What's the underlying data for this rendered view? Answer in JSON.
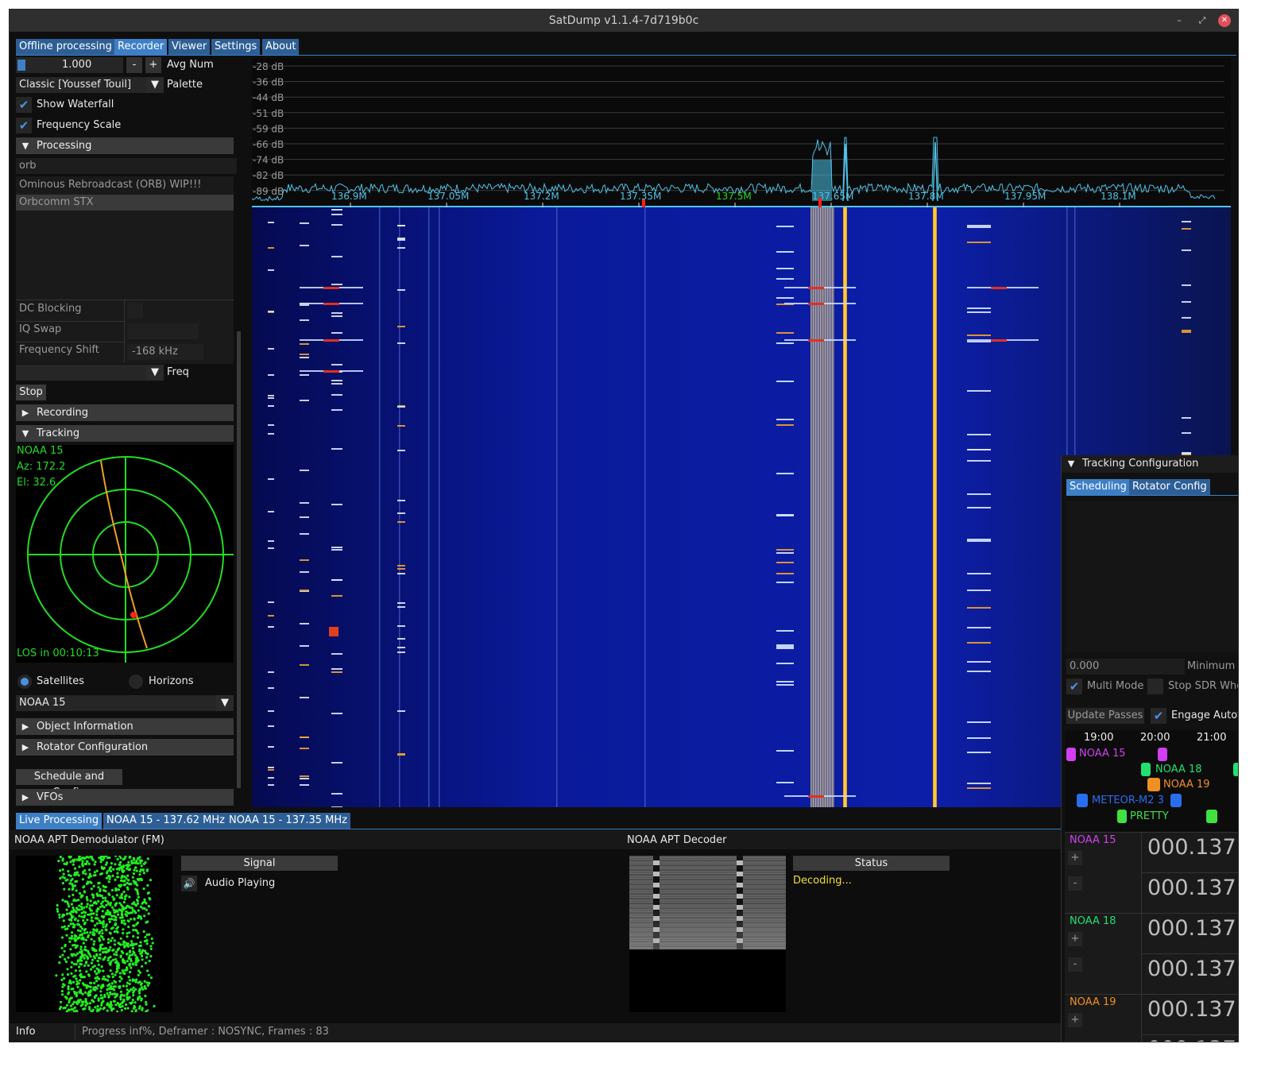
{
  "window": {
    "title": "SatDump v1.1.4-7d719b0c",
    "min": "–",
    "max": "⤢",
    "close": "✕"
  },
  "tabs": [
    "Offline processing",
    "Recorder",
    "Viewer",
    "Settings",
    "About"
  ],
  "left": {
    "avg_value": "1.000",
    "minus": "-",
    "plus": "+",
    "avg_label": "Avg Num",
    "palette_value": "Classic [Youssef Touil]",
    "palette_label": "Palette",
    "show_waterfall": "Show Waterfall",
    "frequency_scale": "Frequency Scale",
    "processing_header": "Processing",
    "pipeline_search": "orb",
    "pipelines": [
      "Ominous Rebroadcast (ORB) WIP!!!",
      "Orbcomm STX"
    ],
    "dc_blocking": "DC Blocking",
    "iq_swap": "IQ Swap",
    "freq_shift_label": "Frequency Shift",
    "freq_shift_value": "-168 kHz",
    "freq_label": "Freq",
    "stop": "Stop",
    "recording": "Recording",
    "tracking": "Tracking",
    "polar": {
      "sat": "NOAA 15",
      "az": "Az: 172.2",
      "el": "El: 32.6",
      "los": "LOS in 00:10:13"
    },
    "satellites": "Satellites",
    "horizons": "Horizons",
    "sat_select": "NOAA 15",
    "object_info": "Object Information",
    "rotator_config": "Rotator Configuration",
    "schedule": "Schedule and Config",
    "vfos": "VFOs"
  },
  "spectrum": {
    "db_labels": [
      "-28 dB",
      "-36 dB",
      "-44 dB",
      "-51 dB",
      "-59 dB",
      "-66 dB",
      "-74 dB",
      "-82 dB",
      "-89 dB"
    ],
    "freq_labels": [
      "136.9M",
      "137.05M",
      "137.2M",
      "137.35M",
      "137.5M",
      "137.65M",
      "137.8M",
      "137.95M",
      "138.1M"
    ],
    "center_color": "#22dd22",
    "trace_color": "#4fc3e8"
  },
  "bottom_tabs": [
    "Live Processing",
    "NOAA 15 - 137.62 MHz",
    "NOAA 15 - 137.35 MHz"
  ],
  "demod": {
    "title": "NOAA APT Demodulator (FM)",
    "signal": "Signal",
    "audio": "Audio Playing"
  },
  "decoder": {
    "title": "NOAA APT Decoder",
    "status": "Status",
    "decoding": "Decoding..."
  },
  "statusbar": {
    "info": "Info",
    "text": "Progress inf%, Deframer : NOSYNC, Frames : 83"
  },
  "tracking_config": {
    "title": "Tracking Configuration",
    "tab_scheduling": "Scheduling",
    "tab_rotator": "Rotator Config",
    "min_value": "0.000",
    "min_label": "Minimum I",
    "multi_mode": "Multi Mode",
    "stop_sdr": "Stop SDR Whe",
    "update_passes": "Update Passes",
    "engage": "Engage Autotr",
    "times": [
      "19:00",
      "20:00",
      "21:00"
    ],
    "passes": [
      {
        "name": "NOAA 15",
        "color": "#d040f0"
      },
      {
        "name": "NOAA 18",
        "color": "#22e070"
      },
      {
        "name": "NOAA 19",
        "color": "#f09020"
      },
      {
        "name": "METEOR-M2 3",
        "color": "#2a6ef0"
      },
      {
        "name": "PRETTY",
        "color": "#40e040"
      }
    ],
    "vfo_sats": [
      {
        "name": "NOAA 15",
        "color": "#d040f0"
      },
      {
        "name": "NOAA 18",
        "color": "#22e070"
      },
      {
        "name": "NOAA 19",
        "color": "#f09020"
      }
    ],
    "vfo_value": "000.137.",
    "plus": "+",
    "minus": "-"
  }
}
